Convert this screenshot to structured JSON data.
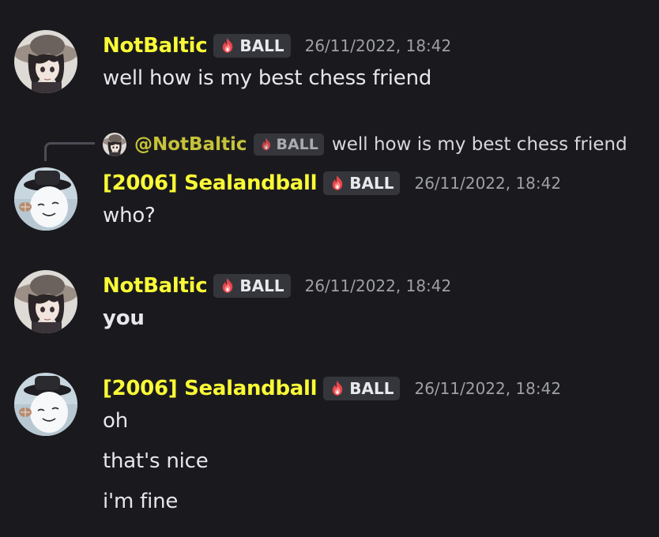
{
  "users": {
    "notbaltic": {
      "name": "NotBaltic",
      "mention": "@NotBaltic"
    },
    "sealandball": {
      "name": "[2006] Sealandball"
    }
  },
  "tag_label": "BALL",
  "messages": [
    {
      "author": "NotBaltic",
      "tag": "BALL",
      "timestamp": "26/11/2022, 18:42",
      "lines": [
        "well how is my best chess friend"
      ]
    },
    {
      "reply_to": {
        "mention": "@NotBaltic",
        "tag": "BALL",
        "text": "well how is my best chess friend"
      },
      "author": "[2006] Sealandball",
      "tag": "BALL",
      "timestamp": "26/11/2022, 18:42",
      "lines": [
        "who?"
      ]
    },
    {
      "author": "NotBaltic",
      "tag": "BALL",
      "timestamp": "26/11/2022, 18:42",
      "lines": [
        "you"
      ]
    },
    {
      "author": "[2006] Sealandball",
      "tag": "BALL",
      "timestamp": "26/11/2022, 18:42",
      "lines": [
        "oh",
        "that's nice",
        "i'm fine"
      ]
    }
  ],
  "colors": {
    "background": "#1a1a1e",
    "username": "#fafa37",
    "reply_username": "#c6c23a",
    "timestamp": "#9ea0a6",
    "tag_background": "#35363b",
    "message_text": "#e6e7ea"
  }
}
